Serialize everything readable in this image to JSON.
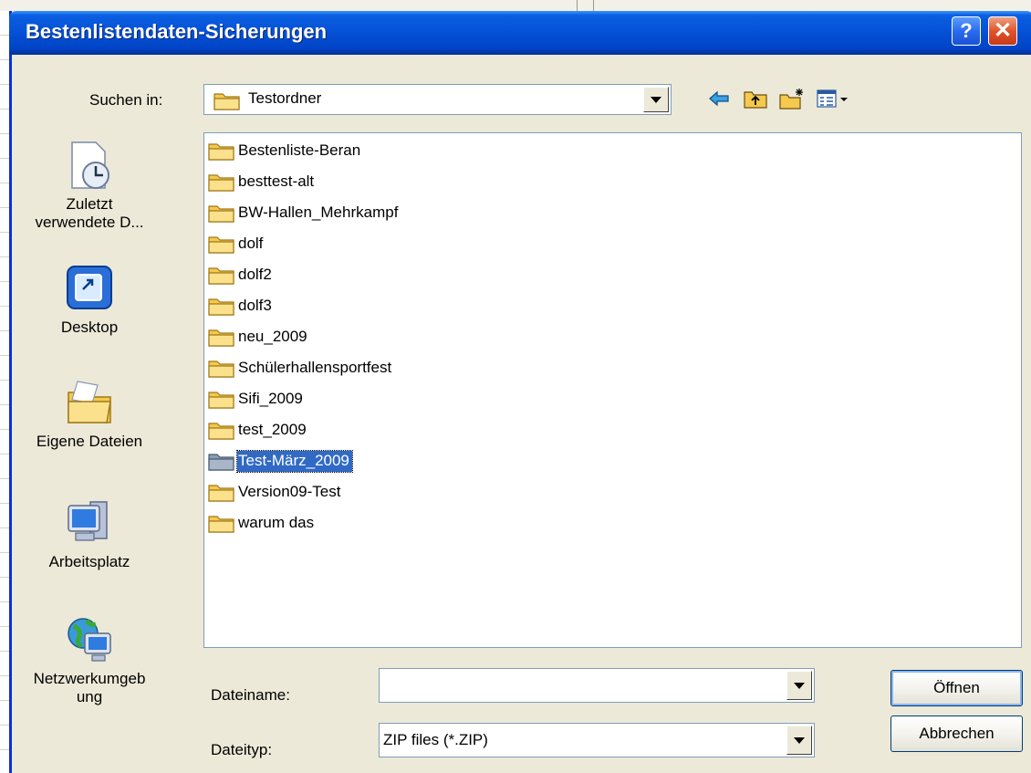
{
  "dialog": {
    "title": "Bestenlistendaten-Sicherungen",
    "help_label": "?",
    "close_label": "✕"
  },
  "lookin": {
    "label": "Suchen in:",
    "value": "Testordner"
  },
  "toolbar": {
    "icons": [
      "back-icon",
      "up-folder-icon",
      "new-folder-icon",
      "view-menu-icon"
    ]
  },
  "places": [
    {
      "label": "Zuletzt verwendete D...",
      "icon": "recent-documents-icon"
    },
    {
      "label": "Desktop",
      "icon": "desktop-icon"
    },
    {
      "label": "Eigene Dateien",
      "icon": "my-documents-icon"
    },
    {
      "label": "Arbeitsplatz",
      "icon": "my-computer-icon"
    },
    {
      "label": "Netzwerkumgebung",
      "icon": "network-places-icon"
    }
  ],
  "files": [
    "Bestenliste-Beran",
    "besttest-alt",
    "BW-Hallen_Mehrkampf",
    "dolf",
    "dolf2",
    "dolf3",
    "neu_2009",
    "Schülerhallensportfest",
    "Sifi_2009",
    "test_2009",
    "Test-März_2009",
    "Version09-Test",
    "warum das"
  ],
  "selected_file": "Test-März_2009",
  "filename": {
    "label": "Dateiname:",
    "value": ""
  },
  "filetype": {
    "label": "Dateityp:",
    "value": "ZIP files (*.ZIP)"
  },
  "buttons": {
    "open": "Öffnen",
    "cancel": "Abbrechen"
  },
  "colors": {
    "titlebar": "#0552d8",
    "selection": "#316ac5",
    "face": "#ece9d8"
  }
}
